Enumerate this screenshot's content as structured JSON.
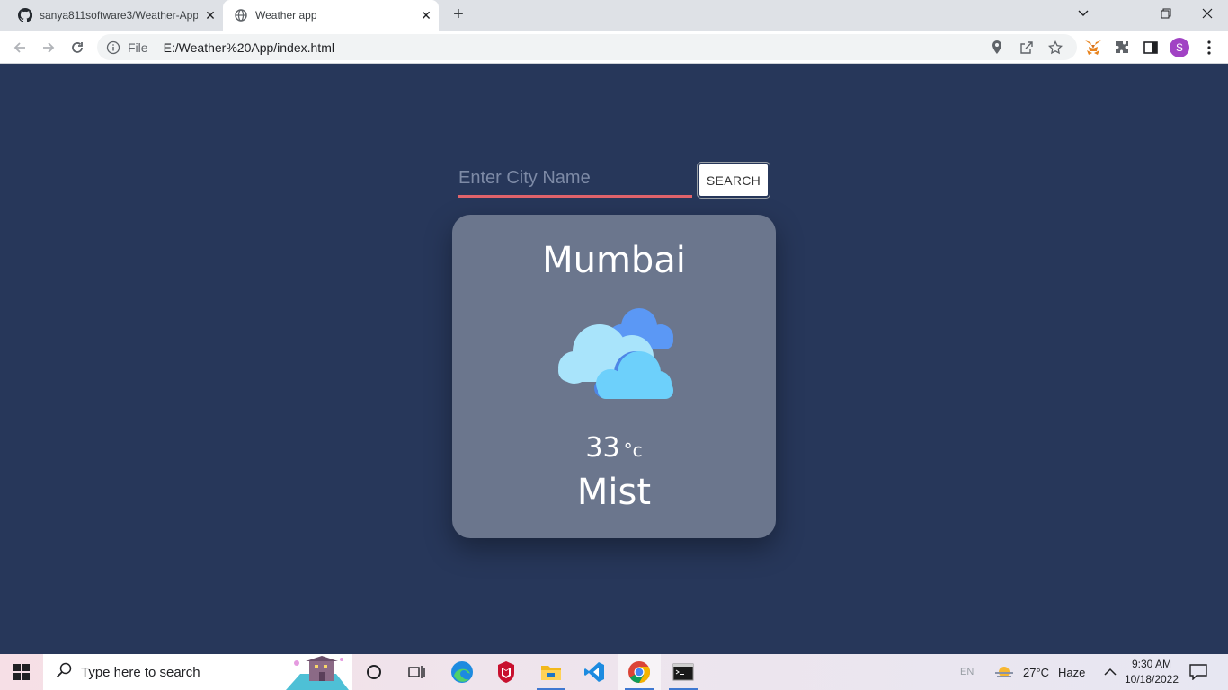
{
  "browser": {
    "tabs": [
      {
        "title": "sanya811software3/Weather-App",
        "icon": "github-icon"
      },
      {
        "title": "Weather app",
        "icon": "globe-icon"
      }
    ],
    "url_scheme_label": "File",
    "url": "E:/Weather%20App/index.html",
    "profile_initial": "S"
  },
  "app": {
    "search": {
      "placeholder": "Enter City Name",
      "value": "",
      "button_label": "SEARCH"
    },
    "card": {
      "city": "Mumbai",
      "icon": "clouds-icon",
      "temperature": "33",
      "unit": "°c",
      "condition": "Mist"
    }
  },
  "taskbar": {
    "search_placeholder": "Type here to search",
    "language": "EN",
    "weather_temp": "27°C",
    "weather_cond": "Haze",
    "time": "9:30 AM",
    "date": "10/18/2022"
  },
  "colors": {
    "background": "#27375a",
    "card": "#6b768d",
    "input_underline": "#e0636b"
  }
}
